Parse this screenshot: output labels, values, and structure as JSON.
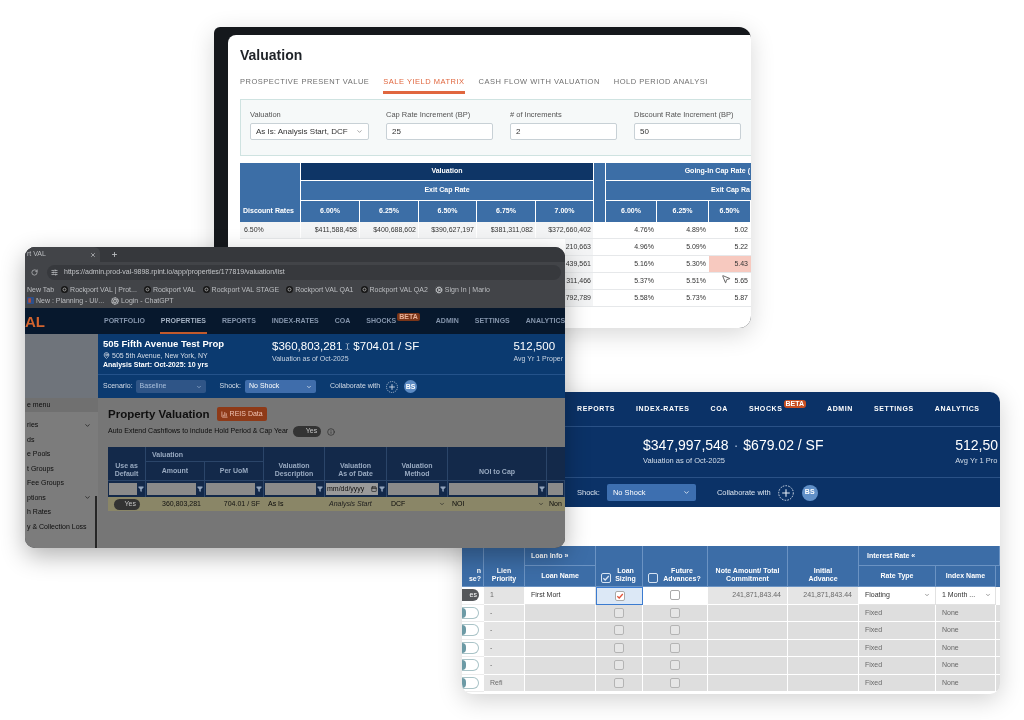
{
  "valuation_window": {
    "title": "Valuation",
    "tabs": [
      {
        "label": "PROSPECTIVE PRESENT VALUE",
        "selected": false
      },
      {
        "label": "SALE YIELD MATRIX",
        "selected": true
      },
      {
        "label": "CASH FLOW WITH VALUATION",
        "selected": false
      },
      {
        "label": "HOLD PERIOD ANALYSI",
        "selected": false
      }
    ],
    "fields": [
      {
        "label": "Valuation",
        "kind": "select",
        "value": "As Is: Analysis Start, DCF"
      },
      {
        "label": "Cap Rate Increment (BP)",
        "kind": "input",
        "value": "25"
      },
      {
        "label": "# of Increments",
        "kind": "input",
        "value": "2"
      },
      {
        "label": "Discount Rate Increment (BP)",
        "kind": "input",
        "value": "50"
      }
    ],
    "matrix": {
      "corner_header": "Discount Rates",
      "valuation_group": {
        "title": "Valuation",
        "subtitle": "Exit Cap Rate",
        "columns": [
          "6.00%",
          "6.25%",
          "6.50%",
          "6.75%",
          "7.00%"
        ]
      },
      "going_in_group": {
        "title": "Going-In Cap Rate (",
        "subtitle": "Exit Cap Ra",
        "columns": [
          "6.00%",
          "6.25%",
          "6.50%"
        ]
      },
      "rows": [
        {
          "discount_rate": "6.50%",
          "valuations": [
            "$411,588,458",
            "$400,688,602",
            "$390,627,197",
            "$381,311,082",
            "$372,660,402"
          ],
          "going_in": [
            {
              "value": "4.76%",
              "highlighted": false
            },
            {
              "value": "4.89%",
              "highlighted": false
            },
            {
              "value": "5.02",
              "highlighted": false
            }
          ]
        },
        {
          "valuations": [
            "210,663"
          ],
          "going_in": [
            {
              "value": "4.96%",
              "highlighted": false
            },
            {
              "value": "5.09%",
              "highlighted": false
            },
            {
              "value": "5.22",
              "highlighted": false
            }
          ]
        },
        {
          "valuations": [
            "439,561"
          ],
          "going_in": [
            {
              "value": "5.16%",
              "highlighted": false
            },
            {
              "value": "5.30%",
              "highlighted": false
            },
            {
              "value": "5.43",
              "highlighted": true
            }
          ]
        },
        {
          "valuations": [
            "311,466"
          ],
          "going_in": [
            {
              "value": "5.37%",
              "highlighted": false
            },
            {
              "value": "5.51%",
              "highlighted": false
            },
            {
              "value": "5.65",
              "highlighted": false
            }
          ]
        },
        {
          "valuations": [
            "792,789"
          ],
          "going_in": [
            {
              "value": "5.58%",
              "highlighted": false
            },
            {
              "value": "5.73%",
              "highlighted": false
            },
            {
              "value": "5.87",
              "highlighted": false
            }
          ]
        }
      ]
    }
  },
  "property_window": {
    "browser": {
      "tab_title": "rt VAL",
      "url": "https://admin.prod-val-9898.rpint.io/app/properties/177819/valuation/list",
      "bookmarks": [
        {
          "label": "New Tab",
          "kind": "plain"
        },
        {
          "label": "Rockport VAL | Prot...",
          "kind": "site"
        },
        {
          "label": "Rockport VAL",
          "kind": "site"
        },
        {
          "label": "Rockport VAL STAGE",
          "kind": "site"
        },
        {
          "label": "Rockport VAL QA1",
          "kind": "site"
        },
        {
          "label": "Rockport VAL QA2",
          "kind": "site"
        },
        {
          "label": "Sign In | Mario",
          "kind": "gear"
        },
        {
          "label": "New : Planning - UI/...",
          "kind": "tile"
        },
        {
          "label": "Login - ChatGPT",
          "kind": "swirl"
        }
      ]
    },
    "nav": {
      "logo": "AL",
      "items": [
        {
          "label": "PORTFOLIO",
          "selected": false
        },
        {
          "label": "PROPERTIES",
          "selected": true
        },
        {
          "label": "REPORTS",
          "selected": false
        },
        {
          "label": "INDEX-RATES",
          "selected": false
        },
        {
          "label": "COA",
          "selected": false
        },
        {
          "label": "SHOCKS",
          "selected": false,
          "badge": "BETA"
        },
        {
          "label": "ADMIN",
          "selected": false
        },
        {
          "label": "SETTINGS",
          "selected": false
        },
        {
          "label": "ANALYTICS",
          "selected": false
        }
      ]
    },
    "property": {
      "name": "505 Fifth Avenue Test Prop",
      "address": "505 5th Avenue, New York, NY",
      "analysis": "Analysis Start: Oct-2025: 10 yrs",
      "valuation": "$360,803,281",
      "per_sf": "$704.01 / SF",
      "valuation_note": "Valuation as of Oct-2025",
      "area": "512,500",
      "area_note": "Avg Yr 1 Proper"
    },
    "controls": {
      "scenario_label": "Scenario:",
      "scenario": "Baseline",
      "scenario_disabled": true,
      "shock_label": "Shock:",
      "shock": "No Shock",
      "collaborate_label": "Collaborate with",
      "avatar": "BS"
    },
    "sidebar": {
      "collapse_label": "e menu",
      "items": [
        {
          "label": "ries",
          "kind": "group"
        },
        {
          "label": "ds",
          "kind": "link"
        },
        {
          "label": "e Pools",
          "kind": "link"
        },
        {
          "label": "t Groups",
          "kind": "link"
        },
        {
          "label": "Fee Groups",
          "kind": "link"
        },
        {
          "label": "ptions",
          "kind": "group"
        },
        {
          "label": "h Rates",
          "kind": "link"
        },
        {
          "label": "y & Collection Loss",
          "kind": "link"
        }
      ]
    },
    "page_title": "Property Valuation",
    "reis_button": "REIS Data",
    "auto_extend": {
      "label": "Auto Extend Cashflows to include Hold Period & Cap Year",
      "on": true,
      "toggle_text": "Yes"
    },
    "table": {
      "group_header": "Valuation",
      "columns": [
        "Use as Default",
        "Amount",
        "Per UoM",
        "Valuation Description",
        "Valuation As of Date",
        "Valuation Method",
        "NOI to Cap"
      ],
      "filters": [
        {
          "kind": "text"
        },
        {
          "kind": "text"
        },
        {
          "kind": "text"
        },
        {
          "kind": "text"
        },
        {
          "kind": "date",
          "placeholder": "mm/dd/yyyy"
        },
        {
          "kind": "text"
        },
        {
          "kind": "text"
        },
        {
          "kind": "text_cut"
        }
      ],
      "row": {
        "default": true,
        "toggle_text": "Yes",
        "amount": "360,803,281",
        "per_uom": "704.01 / SF",
        "description": "As Is",
        "as_of_date": "Analysis Start",
        "method": "DCF",
        "noi_to_cap": "NOI",
        "column_8": "Non"
      }
    }
  },
  "loan_window": {
    "nav": [
      {
        "label": "REPORTS"
      },
      {
        "label": "INDEX-RATES"
      },
      {
        "label": "COA"
      },
      {
        "label": "SHOCKS",
        "badge": "BETA"
      },
      {
        "label": "ADMIN"
      },
      {
        "label": "SETTINGS"
      },
      {
        "label": "ANALYTICS"
      }
    ],
    "valuation": "$347,997,548",
    "separator": "·",
    "per_sf": "$679.02 / SF",
    "valuation_note": "Valuation as of Oct-2025",
    "area": "512,50",
    "area_note": "Avg Yr 1 Pro",
    "controls": {
      "shock_label": "Shock:",
      "shock": "No Shock",
      "collaborate_label": "Collaborate with",
      "avatar": "BS"
    },
    "table": {
      "headers": {
        "column_1": "n\nse?",
        "lien_priority": "Lien Priority",
        "loan_info": "Loan Info »",
        "loan_name": "Loan Name",
        "loan_sizing": {
          "label": "Loan Sizing",
          "checked": true
        },
        "future_advances": {
          "label": "Future Advances?",
          "checked": false
        },
        "note_amount": "Note Amount/ Total Commitment",
        "initial_advance": "Initial Advance",
        "interest_rate": "Interest Rate «",
        "rate_type": "Rate Type",
        "index_name": "Index Name"
      },
      "rows": [
        {
          "on": true,
          "toggle_text": "es",
          "editable": true,
          "lien_priority": "1",
          "loan_name": "First Mort",
          "loan_sizing": true,
          "loan_sizing_focused": true,
          "future_advances": false,
          "note_amount": "241,871,843.44",
          "initial_advance": "241,871,843.44",
          "rate_type": "Floating",
          "index_name": "1 Month ..."
        },
        {
          "on": false,
          "editable": false,
          "lien_priority": "-",
          "loan_sizing": false,
          "loan_sizing_focused": false,
          "future_advances": false,
          "rate_type": "Fixed",
          "index_name": "None"
        },
        {
          "on": false,
          "editable": false,
          "lien_priority": "-",
          "loan_sizing": false,
          "loan_sizing_focused": false,
          "future_advances": false,
          "rate_type": "Fixed",
          "index_name": "None"
        },
        {
          "on": false,
          "editable": false,
          "lien_priority": "-",
          "loan_sizing": false,
          "loan_sizing_focused": false,
          "future_advances": false,
          "rate_type": "Fixed",
          "index_name": "None"
        },
        {
          "on": false,
          "editable": false,
          "lien_priority": "-",
          "loan_sizing": false,
          "loan_sizing_focused": false,
          "future_advances": false,
          "rate_type": "Fixed",
          "index_name": "None"
        },
        {
          "on": false,
          "editable": false,
          "lien_priority": "Refi",
          "loan_sizing": false,
          "loan_sizing_focused": false,
          "future_advances": false,
          "rate_type": "Fixed",
          "index_name": "None"
        }
      ]
    }
  }
}
